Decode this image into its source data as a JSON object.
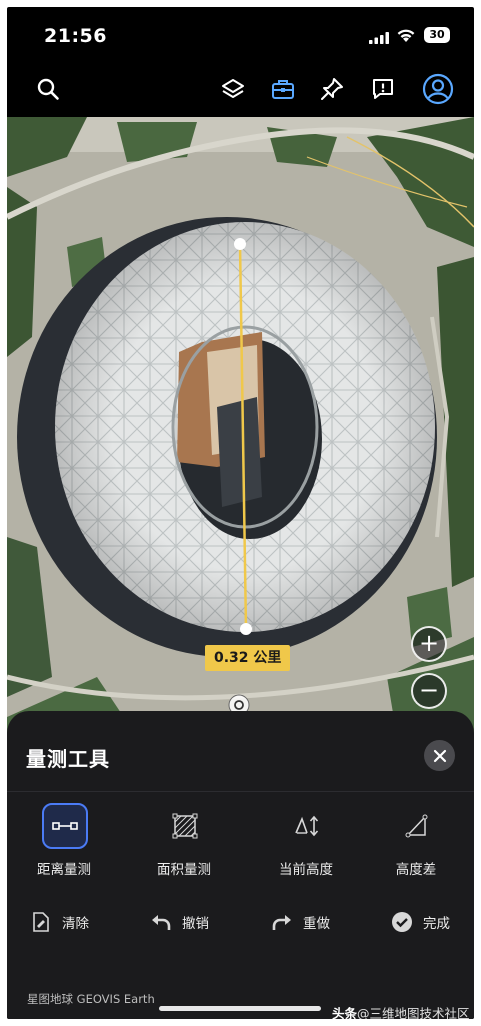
{
  "status_bar": {
    "time": "21:56",
    "battery": "30"
  },
  "toolbar": {
    "icons": [
      "search-icon",
      "layers-icon",
      "toolbox-icon",
      "pin-icon",
      "report-icon",
      "account-icon"
    ]
  },
  "map": {
    "measurement_label": "0.32 公里",
    "zoom_in": "+",
    "zoom_out": "−"
  },
  "panel": {
    "title": "量测工具",
    "tools": [
      {
        "label": "距离量测",
        "active": true,
        "icon": "distance-measure-icon"
      },
      {
        "label": "面积量测",
        "active": false,
        "icon": "area-measure-icon"
      },
      {
        "label": "当前高度",
        "active": false,
        "icon": "current-height-icon"
      },
      {
        "label": "高度差",
        "active": false,
        "icon": "height-difference-icon"
      }
    ],
    "actions": [
      {
        "label": "清除",
        "icon": "clear-icon"
      },
      {
        "label": "撤销",
        "icon": "undo-icon"
      },
      {
        "label": "重做",
        "icon": "redo-icon"
      },
      {
        "label": "完成",
        "icon": "done-icon"
      }
    ],
    "brand": "星图地球 GEOVIS Earth"
  },
  "watermark": {
    "prefix": "头条",
    "text": "@三维地图技术社区"
  },
  "colors": {
    "accent": "#4b7bf5",
    "measure_line": "#f0c84a",
    "panel_bg": "#1b1b1d"
  }
}
